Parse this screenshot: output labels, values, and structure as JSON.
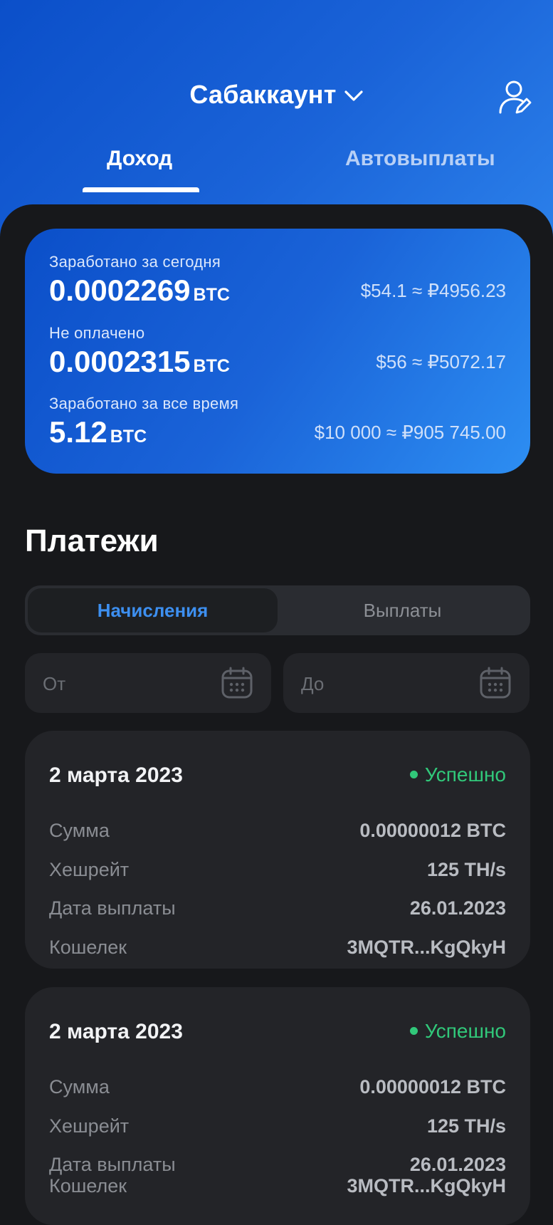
{
  "header": {
    "account_title": "Сабаккаунт",
    "tabs": [
      {
        "label": "Доход",
        "active": true
      },
      {
        "label": "Автовыплаты",
        "active": false
      }
    ]
  },
  "stats": [
    {
      "label": "Заработано за сегодня",
      "value": "0.0002269",
      "unit": "BTC",
      "fiat": "$54.1 ≈ ₽4956.23"
    },
    {
      "label": "Не оплачено",
      "value": "0.0002315",
      "unit": "BTC",
      "fiat": "$56 ≈ ₽5072.17"
    },
    {
      "label": "Заработано за все время",
      "value": "5.12",
      "unit": "BTC",
      "fiat": "$10 000 ≈ ₽905 745.00"
    }
  ],
  "payments": {
    "title": "Платежи",
    "segments": [
      {
        "label": "Начисления",
        "active": true
      },
      {
        "label": "Выплаты",
        "active": false
      }
    ],
    "date_from_placeholder": "От",
    "date_to_placeholder": "До",
    "items": [
      {
        "date": "2 марта 2023",
        "status": "Успешно",
        "rows": [
          {
            "label": "Сумма",
            "value": "0.00000012 BTC"
          },
          {
            "label": "Хешрейт",
            "value": "125 TH/s"
          },
          {
            "label": "Дата выплаты",
            "value": "26.01.2023"
          },
          {
            "label": "Кошелек",
            "value": "3MQTR...KgQkyH"
          }
        ]
      },
      {
        "date": "2 марта 2023",
        "status": "Успешно",
        "rows": [
          {
            "label": "Сумма",
            "value": "0.00000012 BTC"
          },
          {
            "label": "Хешрейт",
            "value": "125 TH/s"
          },
          {
            "label": "Дата выплаты",
            "value": "26.01.2023"
          },
          {
            "label": "Кошелек",
            "value": "3MQTR...KgQkyH"
          }
        ]
      }
    ]
  },
  "colors": {
    "accent_blue": "#3d8ff0",
    "success_green": "#31c87a",
    "background": "#17181b",
    "card": "#232428"
  },
  "icons": [
    "chevron-down-icon",
    "profile-edit-icon",
    "calendar-icon",
    "status-dot-icon"
  ]
}
